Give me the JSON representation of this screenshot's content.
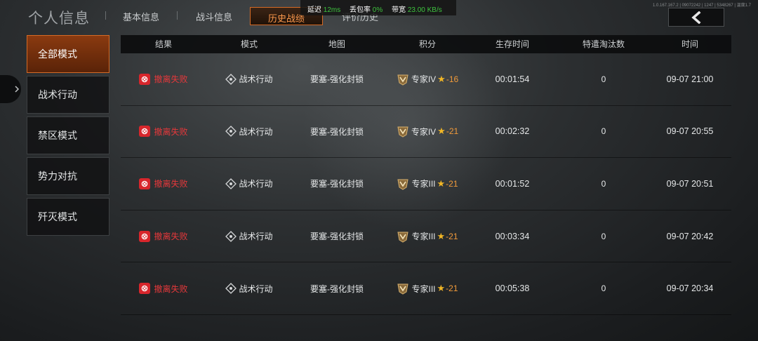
{
  "header": {
    "title": "个人信息",
    "tabs": [
      {
        "label": "基本信息"
      },
      {
        "label": "战斗信息"
      },
      {
        "label": "历史战绩"
      },
      {
        "label": "评价历史"
      }
    ]
  },
  "netstats": {
    "latency_label": "延迟",
    "latency_value": "12ms",
    "loss_label": "丢包率",
    "loss_value": "0%",
    "bandwidth_label": "带宽",
    "bandwidth_value": "23.00 KB/s"
  },
  "debug_id": "1.0.167.167.2 | 09072242 | 1247 | 5348267 | 温度1.7",
  "menu": {
    "items": [
      {
        "label": "全部模式"
      },
      {
        "label": "战术行动"
      },
      {
        "label": "禁区模式"
      },
      {
        "label": "势力对抗"
      },
      {
        "label": "歼灭模式"
      }
    ]
  },
  "table": {
    "columns": [
      "结果",
      "模式",
      "地图",
      "积分",
      "生存时间",
      "特遣淘汰数",
      "时间"
    ],
    "rows": [
      {
        "result": "撤离失败",
        "mode": "战术行动",
        "map": "要塞-强化封锁",
        "rank": "专家IV",
        "score": "-16",
        "survival": "00:01:54",
        "kills": "0",
        "time": "09-07 21:00"
      },
      {
        "result": "撤离失败",
        "mode": "战术行动",
        "map": "要塞-强化封锁",
        "rank": "专家IV",
        "score": "-21",
        "survival": "00:02:32",
        "kills": "0",
        "time": "09-07 20:55"
      },
      {
        "result": "撤离失败",
        "mode": "战术行动",
        "map": "要塞-强化封锁",
        "rank": "专家III",
        "score": "-21",
        "survival": "00:01:52",
        "kills": "0",
        "time": "09-07 20:51"
      },
      {
        "result": "撤离失败",
        "mode": "战术行动",
        "map": "要塞-强化封锁",
        "rank": "专家III",
        "score": "-21",
        "survival": "00:03:34",
        "kills": "0",
        "time": "09-07 20:42"
      },
      {
        "result": "撤离失败",
        "mode": "战术行动",
        "map": "要塞-强化封锁",
        "rank": "专家III",
        "score": "-21",
        "survival": "00:05:38",
        "kills": "0",
        "time": "09-07 20:34"
      }
    ]
  },
  "colors": {
    "accent": "#d56b26",
    "fail": "#e5383b",
    "score": "#f09a3a"
  }
}
